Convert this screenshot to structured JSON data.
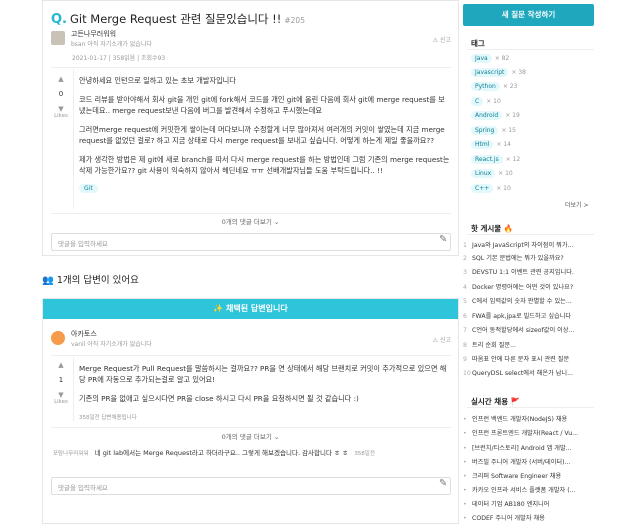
{
  "question": {
    "icon": "Q.",
    "title": "Git Merge Request 관련 질문있습니다 !!",
    "number": "#205",
    "author": "고든나무러워워",
    "author_info": "bsan 아직 자기소개가 없습니다",
    "report": "신고",
    "meta": "2021-01-17 | 358읽음 | 조회수93",
    "votes": "0",
    "likes_label": "Likes",
    "paragraphs": [
      "안녕하세요 인턴으로 일하고 있는 초보 개발자입니다",
      "코드 리뷰를 받아야해서 회사 git을 개인 git에 fork해서 코드를 개인 git에 올린 다음에 회사 git에 merge request를 보냈는데요.. merge request보낸 다음에 버그를 발견해서 수정하고 푸시했는데요",
      "그러면merge request에 커밋한게 쌓이는데 머다보니까 수정할게 너무 많아져서 여러개의 커밋이 쌓였는데 지금 merge request를 없었던 걸로? 하고 지금 상태로 다시 merge request를 보내고 싶습니다. 어떻게 하는게 제일 좋을까요??",
      "제가 생각한 방법은 제 git에 새로 branch를 따서 다시 merge request를 하는 방법인데 그럼 기존의 merge request는 삭제 가능한가요?? git 사용이 익숙하지 않아서 헤딘네요 ㅠㅠ 선배개발자님들 도움 부탁드립니다.. !!"
    ],
    "tag": "Git",
    "more_comments": "0개의 댓글 더보기 ⌄",
    "comment_placeholder": "댓글을 입력하세요"
  },
  "answers_count_label": "1개의 답변이 있어요",
  "answer": {
    "banner": "✨ 채택된 답변입니다",
    "author": "아카토스",
    "author_info": "vanil 아직 자기소개가 없습니다",
    "report": "신고",
    "votes": "1",
    "likes_label": "Likes",
    "paragraphs": [
      "Merge Request가 Pull Request를 말씀하시는 걸까요?? PR을 연 상태에서 해당 브랜치로 커밋이 추가적으로 있으면 해당 PR에 자동으로 추가되는걸로 알고 있어요!",
      "기존의 PR을 없애고 싶으시다면 PR을 close 하시고 다시 PR을 요청하시면 될 것 같습니다 :)"
    ],
    "meta": "358일전 답변채용됩니다",
    "more_comments": "0개의 댓글 더보기 ⌄",
    "comment_author": "포탐나무러워워",
    "comment_text": "네 git lab에서는 Merge Request라고 하더라구요.. 그렇게 해보겠습니다. 감사합니다 ㅎ ㅎ",
    "comment_time": "358일전",
    "comment_placeholder": "댓글을 입력하세요"
  },
  "sidebar": {
    "new_question": "새 질문 작성하기",
    "tags_heading": "태그",
    "tags": [
      {
        "name": "Java",
        "count": "× 82"
      },
      {
        "name": "Javascript",
        "count": "× 38"
      },
      {
        "name": "Python",
        "count": "× 23"
      },
      {
        "name": "C",
        "count": "× 10"
      },
      {
        "name": "Android",
        "count": "× 19"
      },
      {
        "name": "Spring",
        "count": "× 15"
      },
      {
        "name": "Html",
        "count": "× 14"
      },
      {
        "name": "React.js",
        "count": "× 12"
      },
      {
        "name": "Linux",
        "count": "× 10"
      },
      {
        "name": "C++",
        "count": "× 10"
      }
    ],
    "tags_more": "더보기 >",
    "hot_heading": "핫 게시물 🔥",
    "hot_posts": [
      "Java와 JavaScript의 차이점이 뭐가...",
      "SQL 기본 문법에는 뭐가 있을까요?",
      "DEVSTU 1:1 이벤트 관련 공지입니다.",
      "Docker 명령어에는 어떤 것이 있나요?",
      "C에서 입력값의 숫자 판별할 수 있는...",
      "FWA를 apk,jpa로 빌드하고 싶습니다",
      "C언어 동적할당에서 sizeof값이 이상...",
      "트리 순회 질문...",
      "따옴표 안에 다른 문자 표시 관련 질문",
      "QueryDSL select에서 해온가 납니..."
    ],
    "jobs_heading": "실시간 채용 🚩",
    "jobs": [
      "인프런 백엔드 개발자(NodeJS) 채용",
      "인프런 프론트엔드 개발자(React / Vu...",
      "[브런치/티스토리] Android 앱 개발...",
      "버즈빌 주니어 개발자 (서버/데이터)...",
      "크리퍼 Software Engineer 채용",
      "카카오 인프라 서비스 플랫폼 개발자 (...",
      "데이터 기업 AB180 엔지니어",
      "CODEF 주니어 개발자 채용"
    ],
    "accent": "#1ea7bd"
  }
}
